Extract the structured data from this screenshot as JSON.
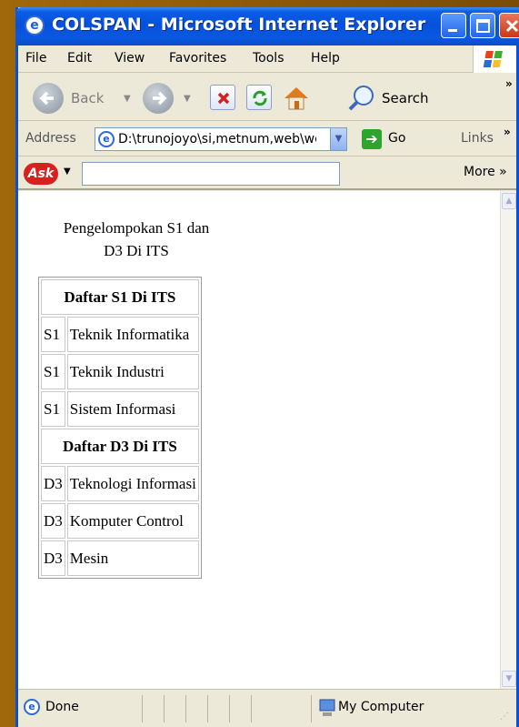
{
  "window": {
    "title": "COLSPAN - Microsoft Internet Explorer"
  },
  "menubar": {
    "items": [
      "File",
      "Edit",
      "View",
      "Favorites",
      "Tools",
      "Help"
    ]
  },
  "toolbar": {
    "back_label": "Back",
    "search_label": "Search",
    "overflow": "»"
  },
  "address_bar": {
    "label": "Address",
    "value": "D:\\trunojoyo\\si,metnum,web\\web",
    "go_label": "Go",
    "links_label": "Links",
    "links_overflow": "»"
  },
  "ask_toolbar": {
    "logo_text": "Ask",
    "search_value": "",
    "more_label": "More »"
  },
  "page": {
    "heading_line1": "Pengelompokan S1 dan",
    "heading_line2": "D3 Di ITS",
    "s1_header": "Daftar S1 Di ITS",
    "s1_rows": [
      {
        "level": "S1",
        "name": "Teknik Informatika"
      },
      {
        "level": "S1",
        "name": "Teknik Industri"
      },
      {
        "level": "S1",
        "name": "Sistem Informasi"
      }
    ],
    "d3_header": "Daftar D3 Di ITS",
    "d3_rows": [
      {
        "level": "D3",
        "name": "Teknologi Informasi"
      },
      {
        "level": "D3",
        "name": "Komputer Control"
      },
      {
        "level": "D3",
        "name": "Mesin"
      }
    ]
  },
  "status_bar": {
    "status": "Done",
    "zone": "My Computer"
  },
  "icons": {
    "ie": "ie-logo-icon",
    "back": "back-arrow-icon",
    "forward": "forward-arrow-icon",
    "stop": "stop-icon",
    "refresh": "refresh-icon",
    "home": "home-icon",
    "search": "search-icon",
    "go": "go-arrow-icon",
    "zone": "computer-icon"
  },
  "colors": {
    "titlebar": "#0651dc",
    "chrome": "#ece9d8",
    "desktop": "#8a5708"
  }
}
